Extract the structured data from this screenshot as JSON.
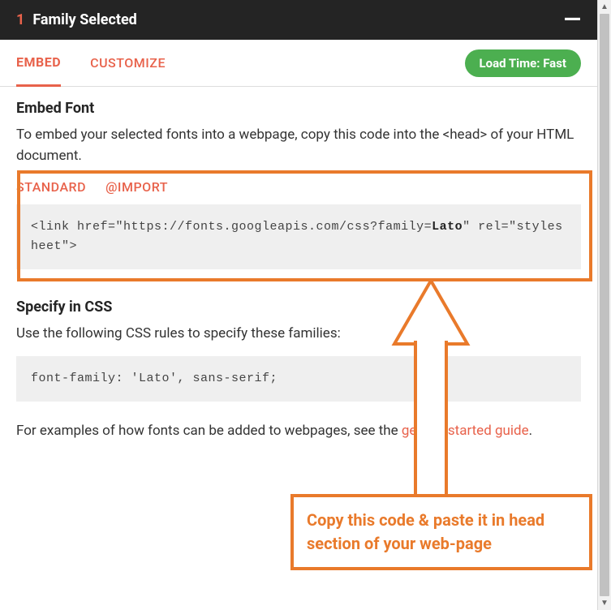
{
  "header": {
    "count": "1",
    "title": "Family Selected",
    "minimize": "—"
  },
  "tabs": {
    "embed": "EMBED",
    "customize": "CUSTOMIZE"
  },
  "loadTime": "Load Time: Fast",
  "embed": {
    "heading": "Embed Font",
    "desc_1": "To embed your selected fonts into a webpage, copy this code into the <head> of your HTML document.",
    "subTabs": {
      "standard": "STANDARD",
      "import": "@IMPORT"
    },
    "code_prefix": "<link href=\"https://fonts.googleapis.com/css?family=",
    "code_family": "Lato",
    "code_suffix": "\" rel=\"stylesheet\">"
  },
  "specify": {
    "heading": "Specify in CSS",
    "desc": "Use the following CSS rules to specify these families:",
    "code": "font-family: 'Lato', sans-serif;"
  },
  "footer": {
    "prefix": "For examples of how fonts can be added to webpages, see the ",
    "linkText": "getting started guide",
    "suffix": "."
  },
  "annotation": "Copy this code & paste it in head section of your web-page"
}
